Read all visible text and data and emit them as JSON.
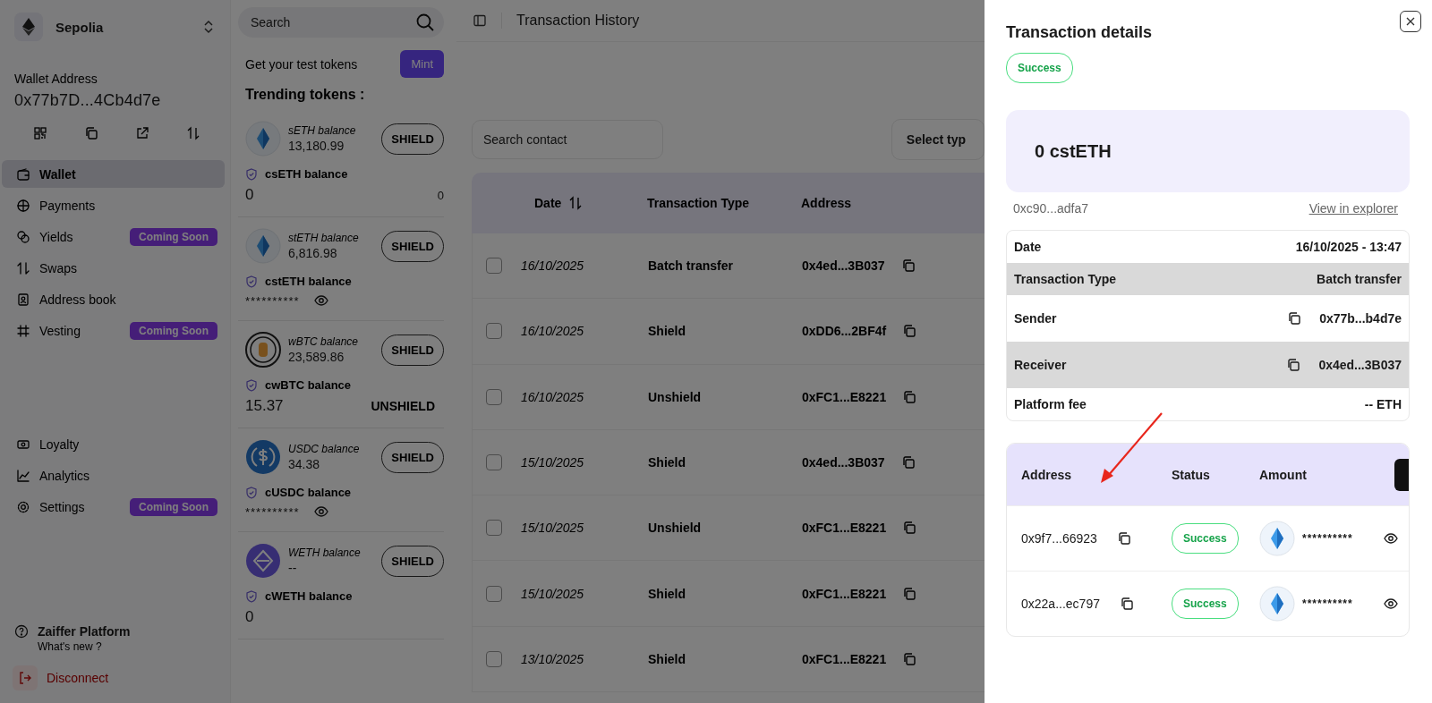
{
  "sidebar": {
    "network": "Sepolia",
    "wallet_label": "Wallet Address",
    "wallet_address": "0x77b7D...4Cb4d7e",
    "nav_items": [
      {
        "label": "Wallet",
        "kind": "wallet",
        "selected": true
      },
      {
        "label": "Payments",
        "kind": "payments",
        "selected": false
      },
      {
        "label": "Yields",
        "kind": "yields",
        "selected": false,
        "badge": "Coming Soon"
      },
      {
        "label": "Swaps",
        "kind": "swaps",
        "selected": false
      },
      {
        "label": "Address book",
        "kind": "book",
        "selected": false
      },
      {
        "label": "Vesting",
        "kind": "vesting",
        "selected": false,
        "badge": "Coming Soon"
      }
    ],
    "secondary_items": [
      {
        "label": "Loyalty",
        "kind": "loyalty",
        "selected": false
      },
      {
        "label": "Analytics",
        "kind": "analytics",
        "selected": false
      },
      {
        "label": "Settings",
        "kind": "settings",
        "selected": false,
        "badge": "Coming Soon"
      }
    ],
    "help": {
      "title": "Zaiffer Platform",
      "subtitle": "What's new ?"
    },
    "disconnect": "Disconnect"
  },
  "tokens": {
    "search_placeholder": "Search",
    "test_tokens_label": "Get your test tokens",
    "mint_button": "Mint",
    "trending_title": "Trending tokens :",
    "items": [
      {
        "kind": "drop",
        "name": "sETH balance",
        "balance": "13,180.99",
        "action": "SHIELD",
        "shielded_name": "csETH balance",
        "shielded_value": "0",
        "masked": false,
        "trailing": {
          "kind": "text",
          "label": "0"
        }
      },
      {
        "kind": "drop",
        "name": "stETH balance",
        "balance": "6,816.98",
        "action": "SHIELD",
        "shielded_name": "cstETH balance",
        "shielded_value": "**********",
        "masked": true
      },
      {
        "kind": "btc",
        "name": "wBTC balance",
        "balance": "23,589.86",
        "action": "SHIELD",
        "shielded_name": "cwBTC balance",
        "shielded_value": "15.37",
        "masked": false,
        "trailing": {
          "kind": "button",
          "label": "UNSHIELD"
        }
      },
      {
        "kind": "usdc",
        "name": "USDC balance",
        "balance": "34.38",
        "action": "SHIELD",
        "shielded_name": "cUSDC balance",
        "shielded_value": "**********",
        "masked": true
      },
      {
        "kind": "weth",
        "name": "WETH balance",
        "balance": "--",
        "action": "SHIELD",
        "shielded_name": "cWETH balance",
        "shielded_value": "0",
        "masked": false
      }
    ]
  },
  "main": {
    "title": "Transaction History",
    "search_placeholder": "Search contact",
    "type_select": "Select typ",
    "columns": [
      {
        "label": "Date",
        "sortable": true
      },
      {
        "label": "Transaction Type",
        "sortable": false
      },
      {
        "label": "Address",
        "sortable": false
      }
    ],
    "rows": [
      {
        "date": "16/10/2025",
        "type": "Batch transfer",
        "address": "0x4ed...3B037",
        "selected": false
      },
      {
        "date": "16/10/2025",
        "type": "Shield",
        "address": "0xDD6...2BF4f",
        "selected": false
      },
      {
        "date": "16/10/2025",
        "type": "Unshield",
        "address": "0xFC1...E8221",
        "selected": false
      },
      {
        "date": "15/10/2025",
        "type": "Shield",
        "address": "0x4ed...3B037",
        "selected": false
      },
      {
        "date": "15/10/2025",
        "type": "Unshield",
        "address": "0xFC1...E8221",
        "selected": false
      },
      {
        "date": "15/10/2025",
        "type": "Shield",
        "address": "0xFC1...E8221",
        "selected": false
      },
      {
        "date": "13/10/2025",
        "type": "Shield",
        "address": "0xFC1...E8221",
        "selected": false
      }
    ]
  },
  "drawer": {
    "title": "Transaction details",
    "status": "Success",
    "amount": "0 cstETH",
    "hash": "0xc90...adfa7",
    "explorer_link": "View in explorer",
    "details": [
      {
        "label": "Date",
        "value": "16/10/2025 - 13:47",
        "copy": false
      },
      {
        "label": "Transaction Type",
        "value": "Batch transfer",
        "copy": false
      },
      {
        "label": "Sender",
        "value": "0x77b...b4d7e",
        "copy": true
      },
      {
        "label": "Receiver",
        "value": "0x4ed...3B037",
        "copy": true
      },
      {
        "label": "Platform fee",
        "value": "-- ETH",
        "copy": false
      }
    ],
    "recipients": {
      "columns": [
        "Address",
        "Status",
        "Amount"
      ],
      "rows": [
        {
          "address": "0x9f7...66923",
          "status": "Success",
          "amount": "**********",
          "masked": true
        },
        {
          "address": "0x22a...ec797",
          "status": "Success",
          "amount": "**********",
          "masked": true
        }
      ]
    }
  }
}
